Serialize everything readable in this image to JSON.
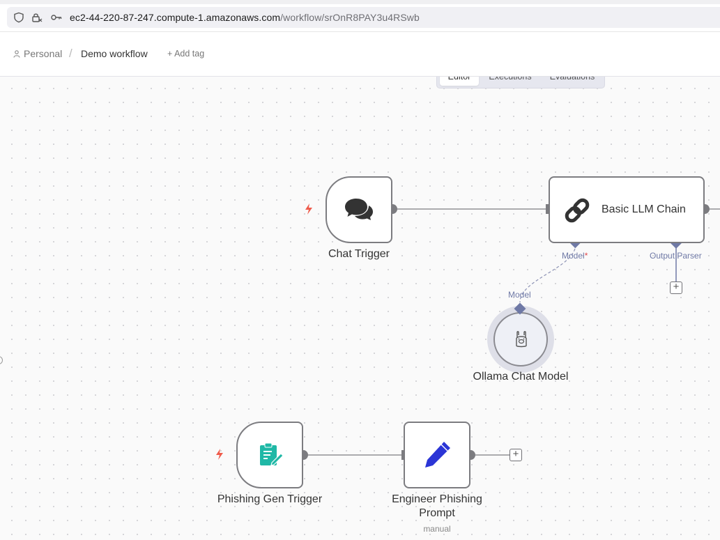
{
  "browser": {
    "url_host": "ec2-44-220-87-247.compute-1.amazonaws.com",
    "url_path": "/workflow/srOnR8PAY3u4RSwb"
  },
  "header": {
    "project": "Personal",
    "separator": "/",
    "workflow_name": "Demo workflow",
    "add_tag": "+ Add tag"
  },
  "tabs": [
    {
      "label": "Editor",
      "active": true
    },
    {
      "label": "Executions",
      "active": false
    },
    {
      "label": "Evaluations",
      "active": false
    }
  ],
  "nodes": {
    "chat_trigger": {
      "label": "Chat Trigger",
      "icon": "chat-bubbles-icon"
    },
    "basic_llm_chain": {
      "label": "Basic LLM Chain",
      "icon": "chain-link-icon"
    },
    "ollama": {
      "label": "Ollama Chat Model",
      "icon": "llama-icon"
    },
    "phishing_trigger": {
      "label": "Phishing Gen Trigger",
      "icon": "form-icon"
    },
    "engineer_prompt": {
      "label": "Engineer Phishing Prompt",
      "sub": "manual",
      "icon": "pencil-icon"
    }
  },
  "ports": {
    "model": "Model",
    "model_required_marker": "*",
    "output_parser": "Output Parser",
    "ollama_model": "Model"
  },
  "colors": {
    "trigger_bolt": "#ef5b4b",
    "port_diamond": "#6f79a6",
    "form_icon": "#1fb8a6",
    "pencil_icon": "#2b35d6",
    "node_border": "#7c7c80"
  }
}
